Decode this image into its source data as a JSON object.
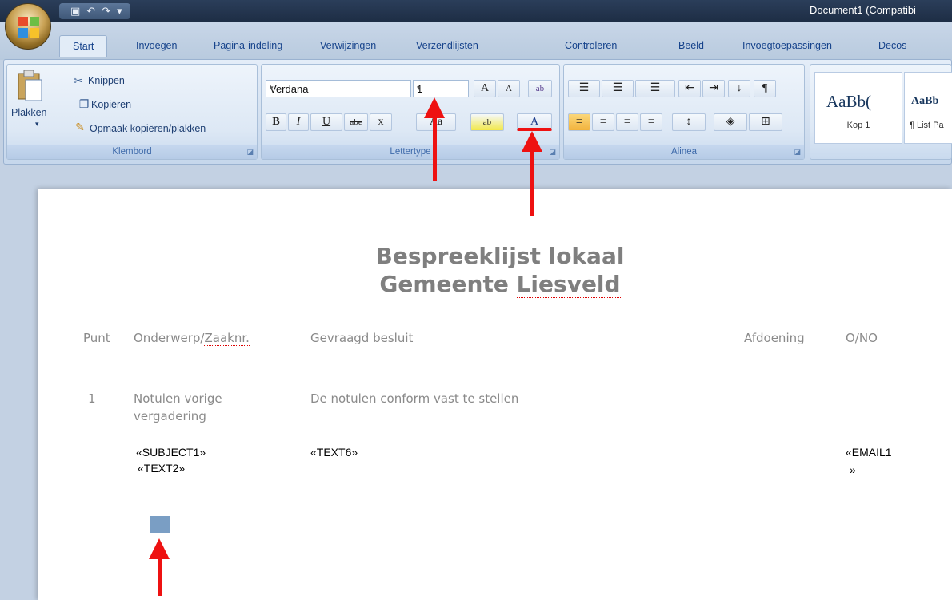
{
  "titlebar": {
    "document_title": "Document1 (Compatibi",
    "qat_icons": [
      "save-icon",
      "undo-icon",
      "redo-icon",
      "customize-icon"
    ],
    "qat_glyphs": [
      "▣",
      "↶",
      "↷",
      "▾"
    ]
  },
  "tabs": [
    {
      "label": "Start",
      "active": true
    },
    {
      "label": "Invoegen"
    },
    {
      "label": "Pagina-indeling"
    },
    {
      "label": "Verwijzingen"
    },
    {
      "label": "Verzendlijsten"
    },
    {
      "label": "Controleren"
    },
    {
      "label": "Beeld"
    },
    {
      "label": "Invoegtoepassingen"
    },
    {
      "label": "Decos"
    }
  ],
  "clipboard": {
    "paste": "Plakken",
    "paste_dd": "▾",
    "cut": "Knippen",
    "copy": "Kopiëren",
    "format_painter": "Opmaak kopiëren/plakken",
    "group_label": "Klembord"
  },
  "font": {
    "font_name": "Verdana",
    "font_size": "1",
    "grow": "A",
    "shrink": "A",
    "clear": "ab",
    "bold": "B",
    "italic": "I",
    "underline": "U",
    "strike": "abe",
    "subscript": "x",
    "change_case": "Aa",
    "highlight": "ab",
    "font_color": "A",
    "group_label": "Lettertype"
  },
  "paragraph": {
    "group_label": "Alinea",
    "pilcrow": "¶",
    "sort": "↓"
  },
  "styles": [
    {
      "sample": "AaBb(",
      "name": "Kop 1"
    },
    {
      "sample": "AaBb",
      "name": "¶ List Pa"
    }
  ],
  "document": {
    "heading_line1": "Bespreeklijst lokaal",
    "heading_line2_a": "Gemeente ",
    "heading_line2_b": "Liesveld",
    "columns": {
      "punt": "Punt",
      "onderwerp_a": "Onderwerp/",
      "onderwerp_b": "Zaaknr.",
      "besluit": "Gevraagd besluit",
      "afdoening": "Afdoening",
      "ono": "O/NO"
    },
    "row1": {
      "num": "1",
      "subject_line1": "Notulen vorige",
      "subject_line2": "vergadering",
      "decision": "De notulen  conform vast te stellen"
    },
    "merge_fields": {
      "subject1": "«SUBJECT1»",
      "text2": "«TEXT2»",
      "text6": "«TEXT6»",
      "email_line1": "«EMAIL1",
      "email_line2": "»"
    }
  },
  "colors": {
    "annotation_arrow": "#e11111",
    "heading_gray": "#7f7f7f",
    "ribbon_text": "#15428b"
  }
}
